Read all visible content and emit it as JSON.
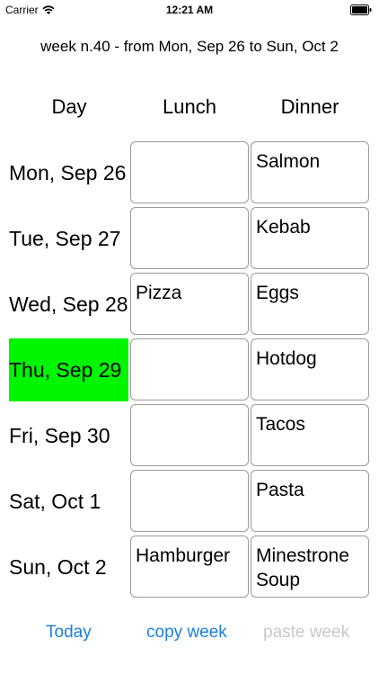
{
  "status": {
    "carrier": "Carrier",
    "time": "12:21 AM"
  },
  "title": "week n.40 - from Mon, Sep 26 to Sun, Oct 2",
  "headers": {
    "day": "Day",
    "lunch": "Lunch",
    "dinner": "Dinner"
  },
  "rows": [
    {
      "day": "Mon, Sep 26",
      "lunch": "",
      "dinner": "Salmon"
    },
    {
      "day": "Tue, Sep 27",
      "lunch": "",
      "dinner": "Kebab"
    },
    {
      "day": "Wed, Sep 28",
      "lunch": "Pizza",
      "dinner": "Eggs"
    },
    {
      "day": "Thu, Sep 29",
      "lunch": "",
      "dinner": "Hotdog",
      "highlight": true
    },
    {
      "day": "Fri, Sep 30",
      "lunch": "",
      "dinner": "Tacos"
    },
    {
      "day": "Sat, Oct 1",
      "lunch": "",
      "dinner": "Pasta"
    },
    {
      "day": "Sun, Oct 2",
      "lunch": "Hamburger",
      "dinner": "Minestrone Soup"
    }
  ],
  "buttons": {
    "today": "Today",
    "copy": "copy week",
    "paste": "paste week"
  },
  "colors": {
    "highlight": "#00f500",
    "accent": "#1a7fe0",
    "disabled": "#c8c8c8"
  },
  "icons": {
    "signal": "wifi-icon",
    "battery": "battery-icon"
  }
}
